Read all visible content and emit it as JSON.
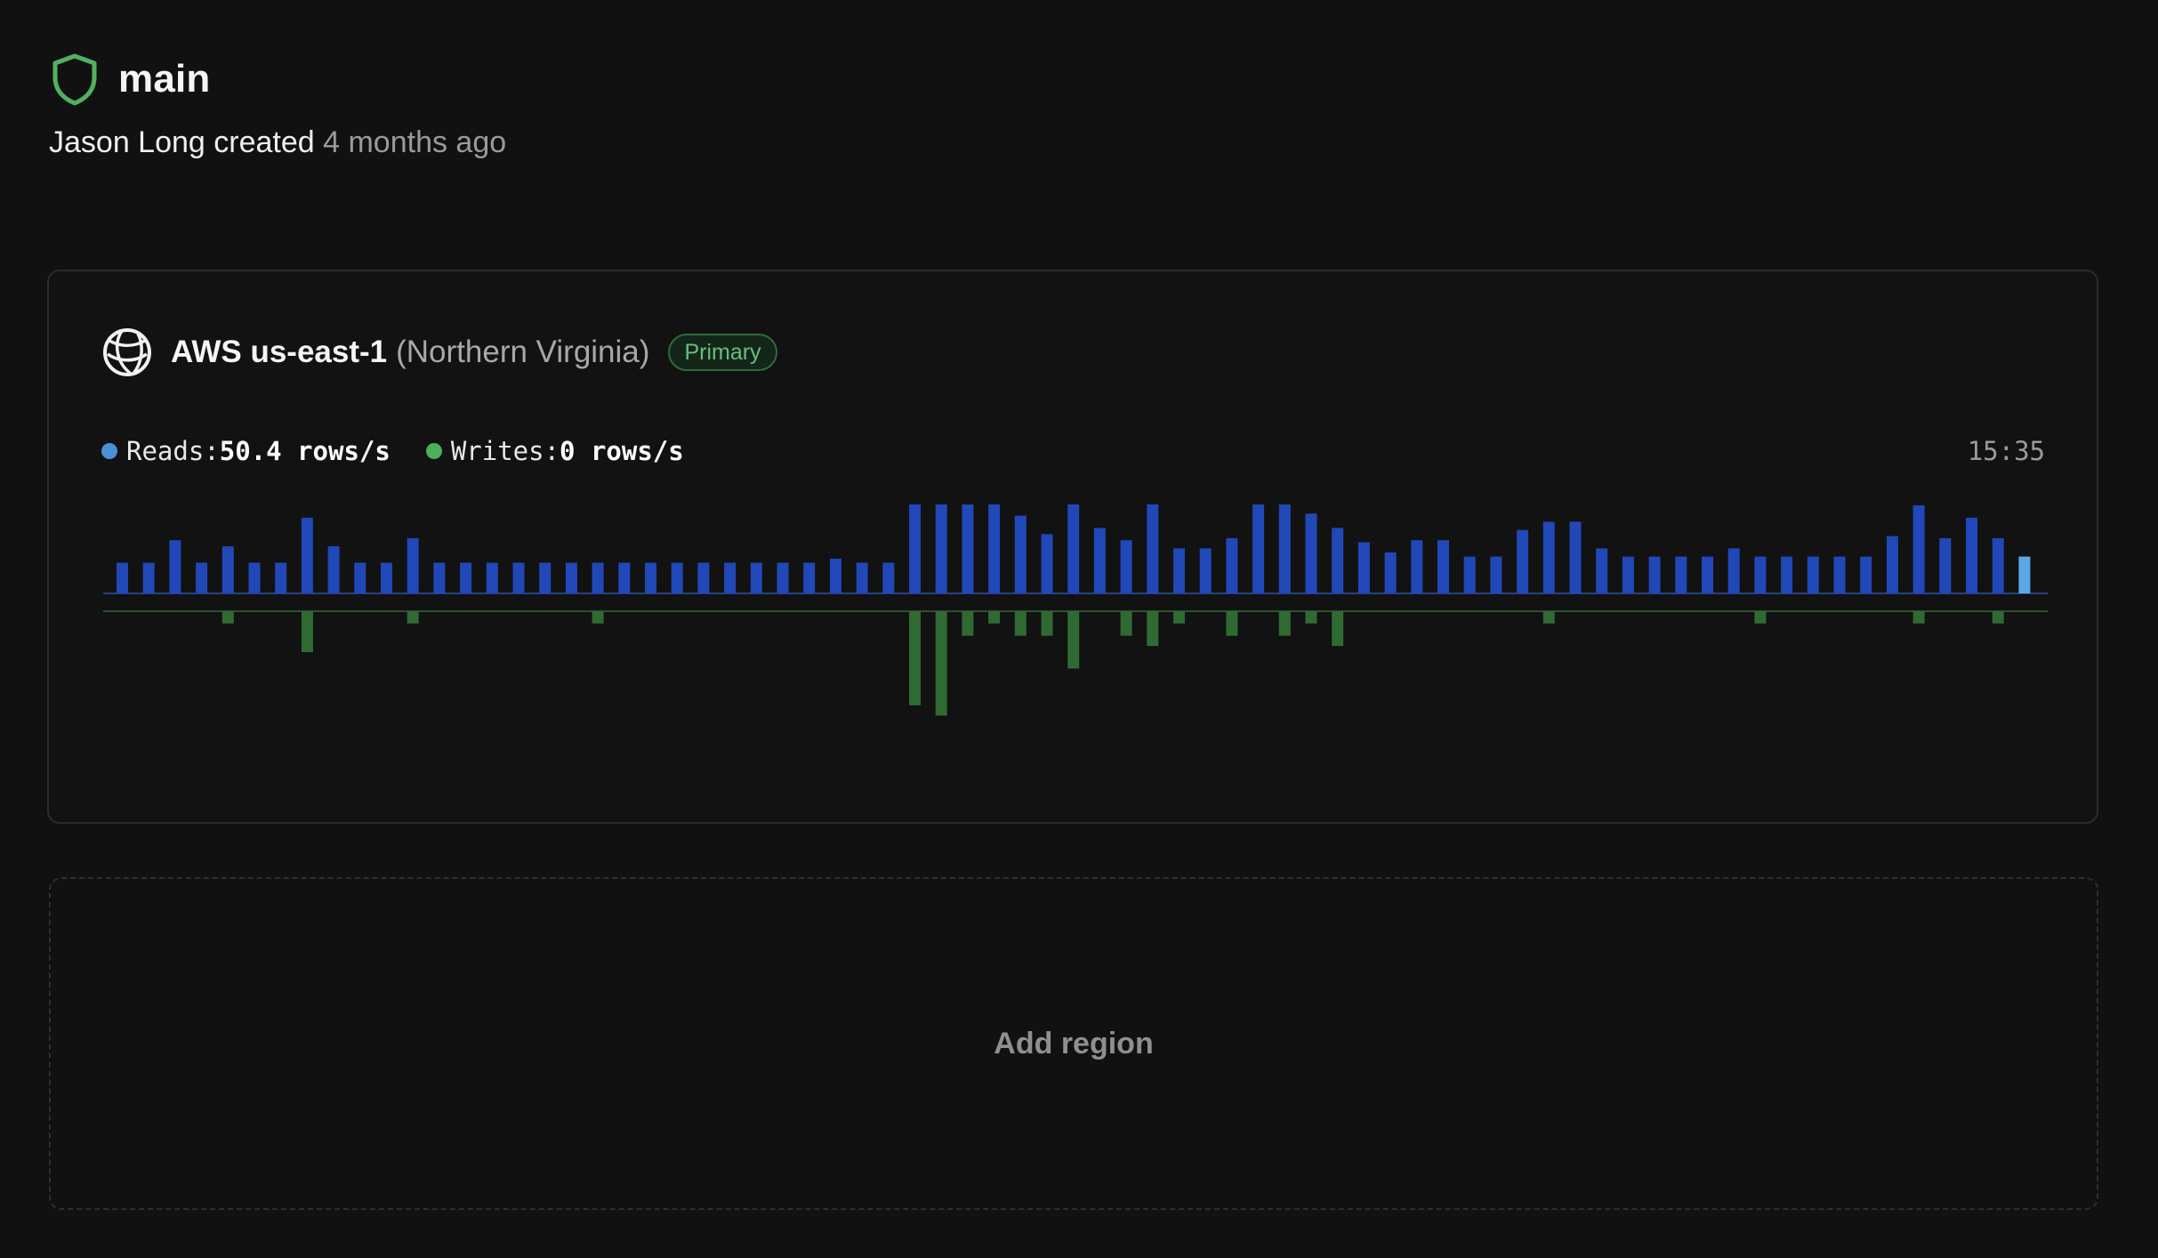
{
  "branch": {
    "icon": "shield-icon",
    "name": "main",
    "created_by": "Jason Long created",
    "created_time": "4 months ago"
  },
  "region": {
    "icon": "globe-icon",
    "name": "AWS us-east-1",
    "location": "(Northern Virginia)",
    "badge": "Primary"
  },
  "legend": {
    "reads_label": "Reads:",
    "reads_value": "50.4 rows/s",
    "writes_label": "Writes:",
    "writes_value": "0 rows/s",
    "time": "15:35"
  },
  "colors": {
    "reads": "#2148b8",
    "reads_current": "#5aa8e6",
    "writes": "#2f6a33",
    "shield": "#52b061",
    "badge": "#66c07a"
  },
  "chart_data": {
    "type": "bar",
    "title": "",
    "xlabel": "",
    "ylabel": "",
    "series": [
      {
        "name": "Reads",
        "values": [
          1.5,
          1.5,
          2.6,
          1.5,
          2.3,
          1.5,
          1.5,
          3.7,
          2.3,
          1.5,
          1.5,
          2.7,
          1.5,
          1.5,
          1.5,
          1.5,
          1.5,
          1.5,
          1.5,
          1.5,
          1.5,
          1.5,
          1.5,
          1.5,
          1.5,
          1.5,
          1.5,
          1.7,
          1.5,
          1.5,
          5.4,
          6,
          5.9,
          4.8,
          3.8,
          2.9,
          5.1,
          3.2,
          2.6,
          4.7,
          2.2,
          2.2,
          2.7,
          5.7,
          4.4,
          3.9,
          3.2,
          2.5,
          2,
          2.6,
          2.6,
          1.8,
          1.8,
          3.1,
          3.5,
          3.5,
          2.2,
          1.8,
          1.8,
          1.8,
          1.8,
          2.2,
          1.8,
          1.8,
          1.8,
          1.8,
          1.8,
          2.8,
          4.3,
          2.7,
          3.7,
          2.7,
          1.8
        ]
      },
      {
        "name": "Writes",
        "values": [
          0,
          0,
          0,
          0,
          0.6,
          0,
          0,
          2,
          0,
          0,
          0,
          0.6,
          0,
          0,
          0,
          0,
          0,
          0,
          0.6,
          0,
          0,
          0,
          0,
          0,
          0,
          0,
          0,
          0,
          0,
          0,
          4.6,
          5.1,
          1.2,
          0.6,
          1.2,
          1.2,
          2.8,
          0,
          1.2,
          1.7,
          0.6,
          0,
          1.2,
          0,
          1.2,
          0.6,
          1.7,
          0,
          0,
          0,
          0,
          0,
          0,
          0,
          0.6,
          0,
          0,
          0,
          0,
          0,
          0,
          0,
          0.6,
          0,
          0,
          0,
          0,
          0,
          0.6,
          0,
          0,
          0.6,
          0
        ]
      }
    ],
    "current_index": 72,
    "grid": false,
    "legend": "top-left"
  }
}
